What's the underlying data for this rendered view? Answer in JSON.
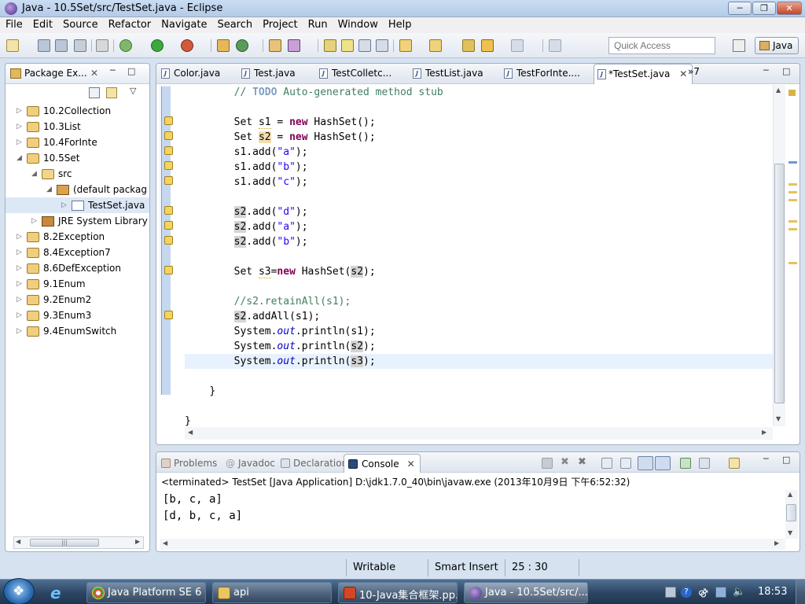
{
  "window": {
    "title": "Java - 10.5Set/src/TestSet.java - Eclipse"
  },
  "menu": [
    "File",
    "Edit",
    "Source",
    "Refactor",
    "Navigate",
    "Search",
    "Project",
    "Run",
    "Window",
    "Help"
  ],
  "toolbar": {
    "quick_access_placeholder": "Quick Access",
    "perspective_label": "Java"
  },
  "package_explorer": {
    "tab_label": "Package Ex...",
    "items": [
      {
        "label": "10.2Collection",
        "level": 0,
        "expanded": false,
        "icon": "project-icon"
      },
      {
        "label": "10.3List",
        "level": 0,
        "expanded": false,
        "icon": "project-icon"
      },
      {
        "label": "10.4ForInte",
        "level": 0,
        "expanded": false,
        "icon": "project-icon"
      },
      {
        "label": "10.5Set",
        "level": 0,
        "expanded": true,
        "icon": "project-icon"
      },
      {
        "label": "src",
        "level": 1,
        "expanded": true,
        "icon": "source-folder-icon"
      },
      {
        "label": "(default packag",
        "level": 2,
        "expanded": true,
        "icon": "package-icon"
      },
      {
        "label": "TestSet.java",
        "level": 3,
        "expanded": false,
        "icon": "java-file-icon"
      },
      {
        "label": "JRE System Library",
        "level": 1,
        "expanded": false,
        "icon": "library-icon"
      },
      {
        "label": "8.2Exception",
        "level": 0,
        "expanded": false,
        "icon": "project-icon"
      },
      {
        "label": "8.4Exception7",
        "level": 0,
        "expanded": false,
        "icon": "project-icon"
      },
      {
        "label": "8.6DefException",
        "level": 0,
        "expanded": false,
        "icon": "project-icon"
      },
      {
        "label": "9.1Enum",
        "level": 0,
        "expanded": false,
        "icon": "project-icon"
      },
      {
        "label": "9.2Enum2",
        "level": 0,
        "expanded": false,
        "icon": "project-icon"
      },
      {
        "label": "9.3Enum3",
        "level": 0,
        "expanded": false,
        "icon": "project-icon"
      },
      {
        "label": "9.4EnumSwitch",
        "level": 0,
        "expanded": false,
        "icon": "project-icon"
      }
    ]
  },
  "editor": {
    "tabs": [
      "Color.java",
      "Test.java",
      "TestColletc...",
      "TestList.java",
      "TestForInte...."
    ],
    "active_tab": "*TestSet.java",
    "more_tabs": "»7",
    "code_text": {
      "todo_comment_prefix": "// ",
      "todo_word": "TODO",
      "todo_rest": " Auto-generated method stub",
      "set": "Set",
      "new": "new",
      "hashset": "HashSet",
      "s1": "s1",
      "s2": "s2",
      "s3": "s3",
      "eq": " = ",
      "eq_tight": "=",
      "call_end": "();",
      "add_open": ".add(",
      "str_a": "\"a\"",
      "str_b": "\"b\"",
      "str_c": "\"c\"",
      "str_d": "\"d\"",
      "close": ");",
      "paren_open": "(",
      "comment_retain": "//s2.retainAll(s1);",
      "addall": ".addAll(",
      "system": "System.",
      "out": "out",
      "println": ".println(",
      "brace_close": "}",
      "space": " "
    }
  },
  "console": {
    "tabs": [
      "Problems",
      "Javadoc",
      "Declaration",
      "Console"
    ],
    "active_tab": "Console",
    "terminated_line": "<terminated> TestSet [Java Application] D:\\jdk1.7.0_40\\bin\\javaw.exe (2013年10月9日 下午6:52:32)",
    "output": [
      "[b, c, a]",
      "[d, b, c, a]"
    ]
  },
  "status_bar": {
    "writable": "Writable",
    "insert_mode": "Smart Insert",
    "position": "25 : 30"
  },
  "taskbar": {
    "tasks": [
      "Java Platform SE 6 ...",
      "api",
      "10-Java集合框架.pp...",
      "Java - 10.5Set/src/..."
    ],
    "clock": "18:53"
  },
  "colors": {
    "keyword": "#7f0055",
    "comment": "#3f7f5f",
    "string": "#2a00ff",
    "field": "#0000c0"
  }
}
